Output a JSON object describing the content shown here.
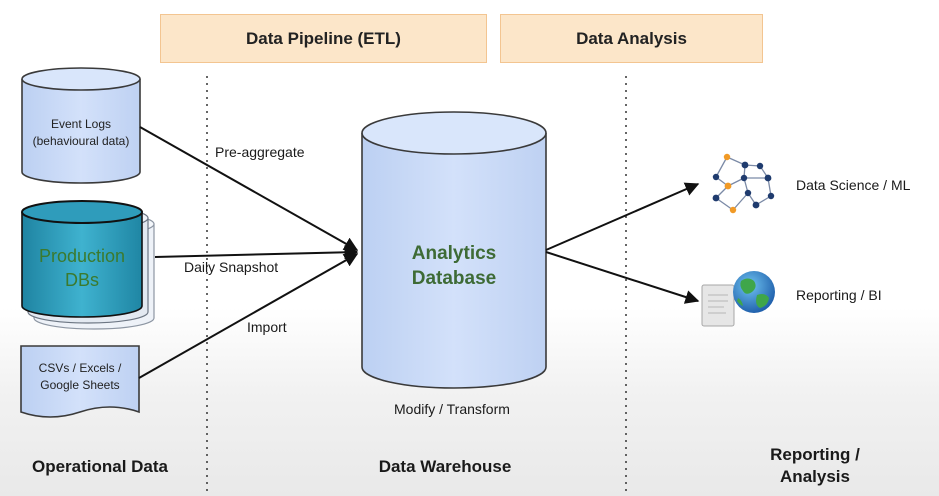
{
  "header": {
    "pipeline": "Data Pipeline (ETL)",
    "analysis": "Data Analysis"
  },
  "sources": {
    "event_logs": "Event Logs (behavioural data)",
    "production_dbs": "Production DBs",
    "spreadsheets": "CSVs / Excels / Google Sheets"
  },
  "edges": {
    "pre_aggregate": "Pre-aggregate",
    "daily_snapshot": "Daily Snapshot",
    "import": "Import"
  },
  "warehouse": {
    "name": "Analytics Database",
    "caption": "Modify / Transform"
  },
  "outputs": {
    "data_science": "Data Science / ML",
    "reporting": "Reporting / BI"
  },
  "footer": {
    "operational": "Operational Data",
    "warehouse": "Data Warehouse",
    "reporting": "Reporting / Analysis"
  },
  "colors": {
    "header_fill": "#fce6c9",
    "cylinder_fill": "#c9daf8",
    "production_fill": "#2a9bb8",
    "label_green": "#3e6b36",
    "network_orange": "#f19a26",
    "network_navy": "#1f3b6e"
  },
  "icons": {
    "data_science": "network-graph-icon",
    "reporting": "globe-report-icon"
  }
}
